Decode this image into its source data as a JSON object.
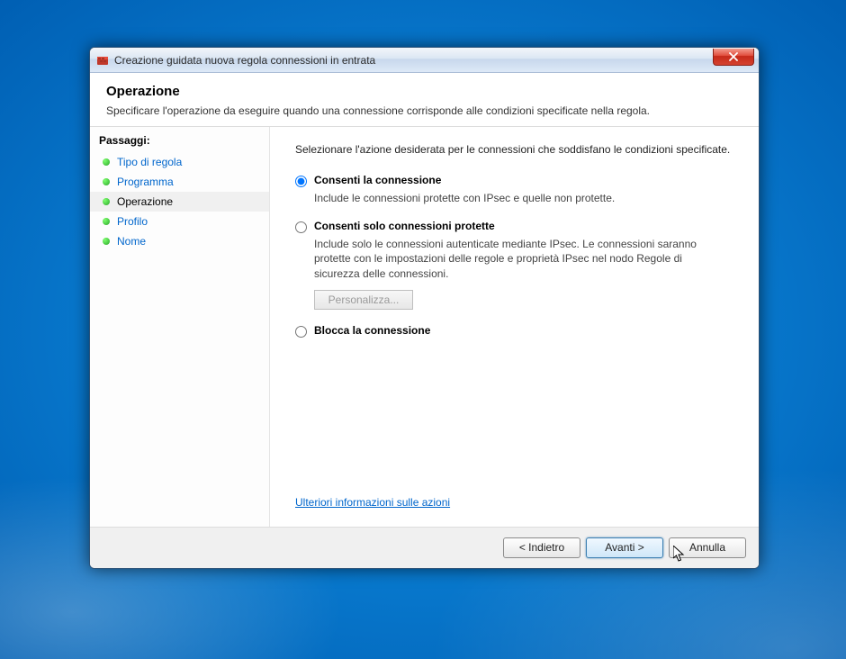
{
  "window": {
    "title": "Creazione guidata nuova regola connessioni in entrata"
  },
  "header": {
    "title": "Operazione",
    "description": "Specificare l'operazione da eseguire quando una connessione corrisponde alle condizioni specificate nella regola."
  },
  "sidebar": {
    "heading": "Passaggi:",
    "steps": [
      {
        "label": "Tipo di regola",
        "active": false
      },
      {
        "label": "Programma",
        "active": false
      },
      {
        "label": "Operazione",
        "active": true
      },
      {
        "label": "Profilo",
        "active": false
      },
      {
        "label": "Nome",
        "active": false
      }
    ]
  },
  "main": {
    "instruction": "Selezionare l'azione desiderata per le connessioni che soddisfano le condizioni specificate.",
    "options": [
      {
        "label": "Consenti la connessione",
        "description": "Include le connessioni protette con IPsec e quelle non protette.",
        "checked": true
      },
      {
        "label": "Consenti solo connessioni protette",
        "description": "Include solo le connessioni autenticate mediante IPsec. Le connessioni saranno protette con le impostazioni delle regole e proprietà IPsec nel nodo Regole di sicurezza delle connessioni.",
        "checked": false,
        "customize": "Personalizza..."
      },
      {
        "label": "Blocca la connessione",
        "description": "",
        "checked": false
      }
    ],
    "more_info": "Ulteriori informazioni sulle azioni"
  },
  "footer": {
    "back": "< Indietro",
    "next": "Avanti >",
    "cancel": "Annulla"
  }
}
